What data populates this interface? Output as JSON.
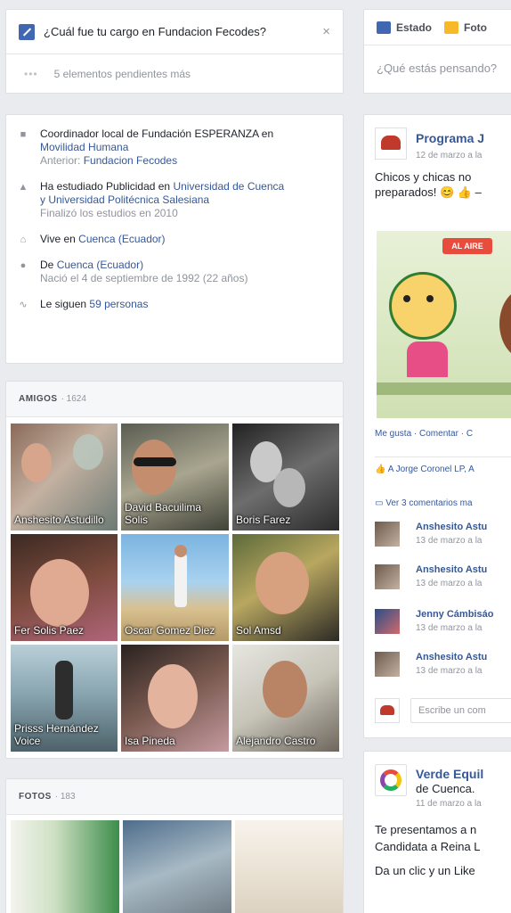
{
  "question": {
    "text": "¿Cuál fue tu cargo en Fundacion Fecodes?",
    "close": "×",
    "pending": "5 elementos pendientes más"
  },
  "intro": {
    "work_line1": "Coordinador local de Fundación ESPERANZA en",
    "work_line2": "Movilidad Humana",
    "work_prev_label": "Anterior: ",
    "work_prev": "Fundacion Fecodes",
    "study_prefix": "Ha estudiado Publicidad en ",
    "study_school1": "Universidad de Cuenca",
    "study_line2": "y Universidad Politécnica Salesiana",
    "study_sub": "Finalizó los estudios en 2010",
    "lives_prefix": "Vive en ",
    "lives_place": "Cuenca (Ecuador)",
    "from_prefix": "De ",
    "from_place": "Cuenca (Ecuador)",
    "born": "Nació el 4 de septiembre de 1992 (22 años)",
    "followers_prefix": "Le siguen ",
    "followers": "59 personas"
  },
  "friends": {
    "title": "AMIGOS",
    "count": "· 1624",
    "items": [
      {
        "name": "Anshesito Astudillo"
      },
      {
        "name": "David Bacuilima Solis"
      },
      {
        "name": "Boris Farez"
      },
      {
        "name": "Fer Solis Paez"
      },
      {
        "name": "Oscar Gomez Diez"
      },
      {
        "name": "Sol Amsd"
      },
      {
        "name": "Prisss Hernández Voice"
      },
      {
        "name": "Isa Pineda"
      },
      {
        "name": "Alejandro Castro"
      }
    ]
  },
  "photos": {
    "title": "FOTOS",
    "count": "· 183"
  },
  "composer": {
    "tab_status": "Estado",
    "tab_photo": "Foto",
    "prompt": "¿Qué estás pensando?"
  },
  "post1": {
    "page": "Programa J",
    "date": "12 de marzo a la",
    "text1": "Chicos y chicas no",
    "text2": "preparados! 😊 👍 –",
    "image_label": "AL AIRE",
    "actions": "Me gusta · Comentar · C",
    "likes": "A Jorge Coronel LP, A",
    "more_comments": "Ver 3 comentarios ma",
    "comments": [
      {
        "name": "Anshesito Astu",
        "date": "13 de marzo a la"
      },
      {
        "name": "Anshesito Astu",
        "date": "13 de marzo a la"
      },
      {
        "name": "Jenny Cámbisáo",
        "date": "13 de marzo a la"
      },
      {
        "name": "Anshesito Astu",
        "date": "13 de marzo a la"
      }
    ],
    "write_placeholder": "Escribe un com"
  },
  "post2": {
    "page": "Verde Equil",
    "page2": "de Cuenca.",
    "date": "11 de marzo a la",
    "text1": "Te presentamos a n",
    "text2": "Candidata a Reina L",
    "text3": "Da un clic y un Like"
  },
  "colors": {
    "brand": "#4267b2",
    "link": "#365899",
    "bg": "#e9ebee"
  }
}
